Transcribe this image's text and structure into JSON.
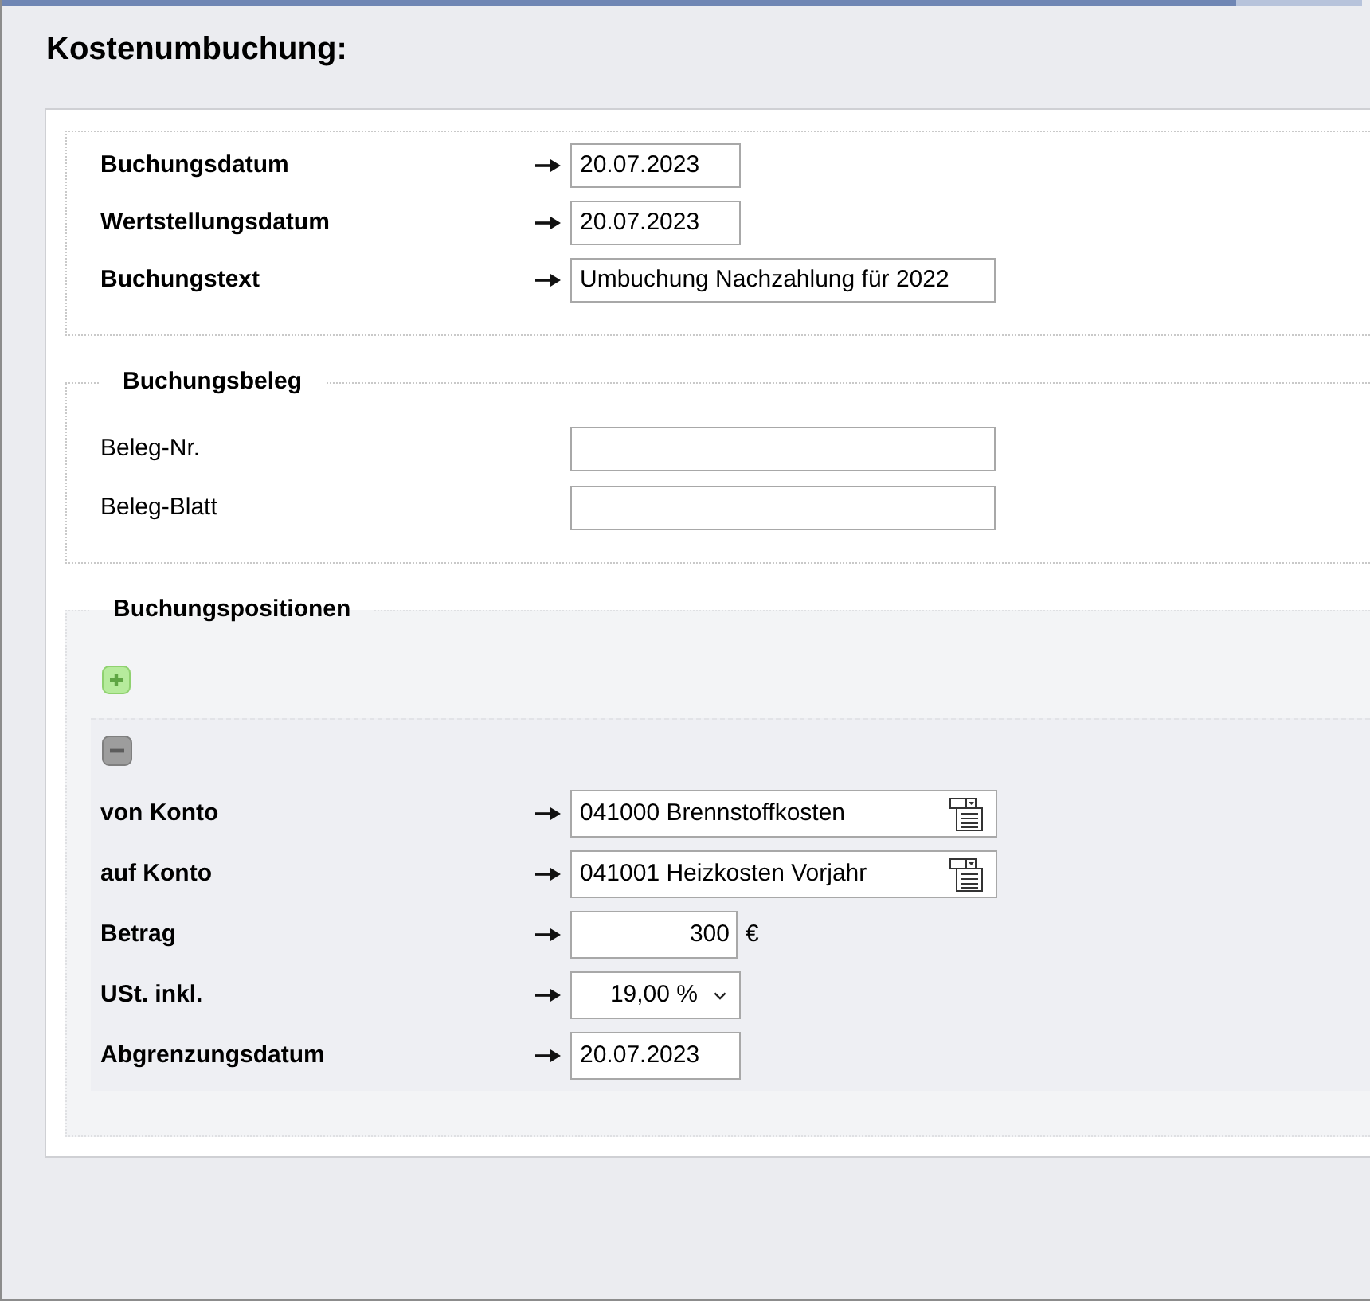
{
  "title": "Kostenumbuchung:",
  "booking": {
    "fields": [
      {
        "label": "Buchungsdatum",
        "required": true,
        "kind": "date",
        "value": "20.07.2023"
      },
      {
        "label": "Wertstellungsdatum",
        "required": true,
        "kind": "date",
        "value": "20.07.2023"
      },
      {
        "label": "Buchungstext",
        "required": true,
        "kind": "text",
        "value": "Umbuchung Nachzahlung für 2022"
      }
    ]
  },
  "voucher": {
    "legend": "Buchungsbeleg",
    "fields": [
      {
        "label": "Beleg-Nr.",
        "required": false,
        "kind": "text"
      },
      {
        "label": "Beleg-Blatt",
        "required": false,
        "kind": "text"
      }
    ]
  },
  "positions": {
    "legend": "Buchungspositionen",
    "items": [
      {
        "fields": [
          {
            "label": "von Konto",
            "required": true,
            "kind": "lookup",
            "value": "041000 Brennstoffkosten"
          },
          {
            "label": "auf Konto",
            "required": true,
            "kind": "lookup",
            "value": "041001 Heizkosten Vorjahr"
          },
          {
            "label": "Betrag",
            "required": true,
            "kind": "amount",
            "value": "300",
            "unit": "€"
          },
          {
            "label": "USt. inkl.",
            "required": true,
            "kind": "select",
            "value": "19,00 %"
          },
          {
            "label": "Abgrenzungsdatum",
            "required": true,
            "kind": "date",
            "value": "20.07.2023"
          }
        ]
      }
    ]
  }
}
